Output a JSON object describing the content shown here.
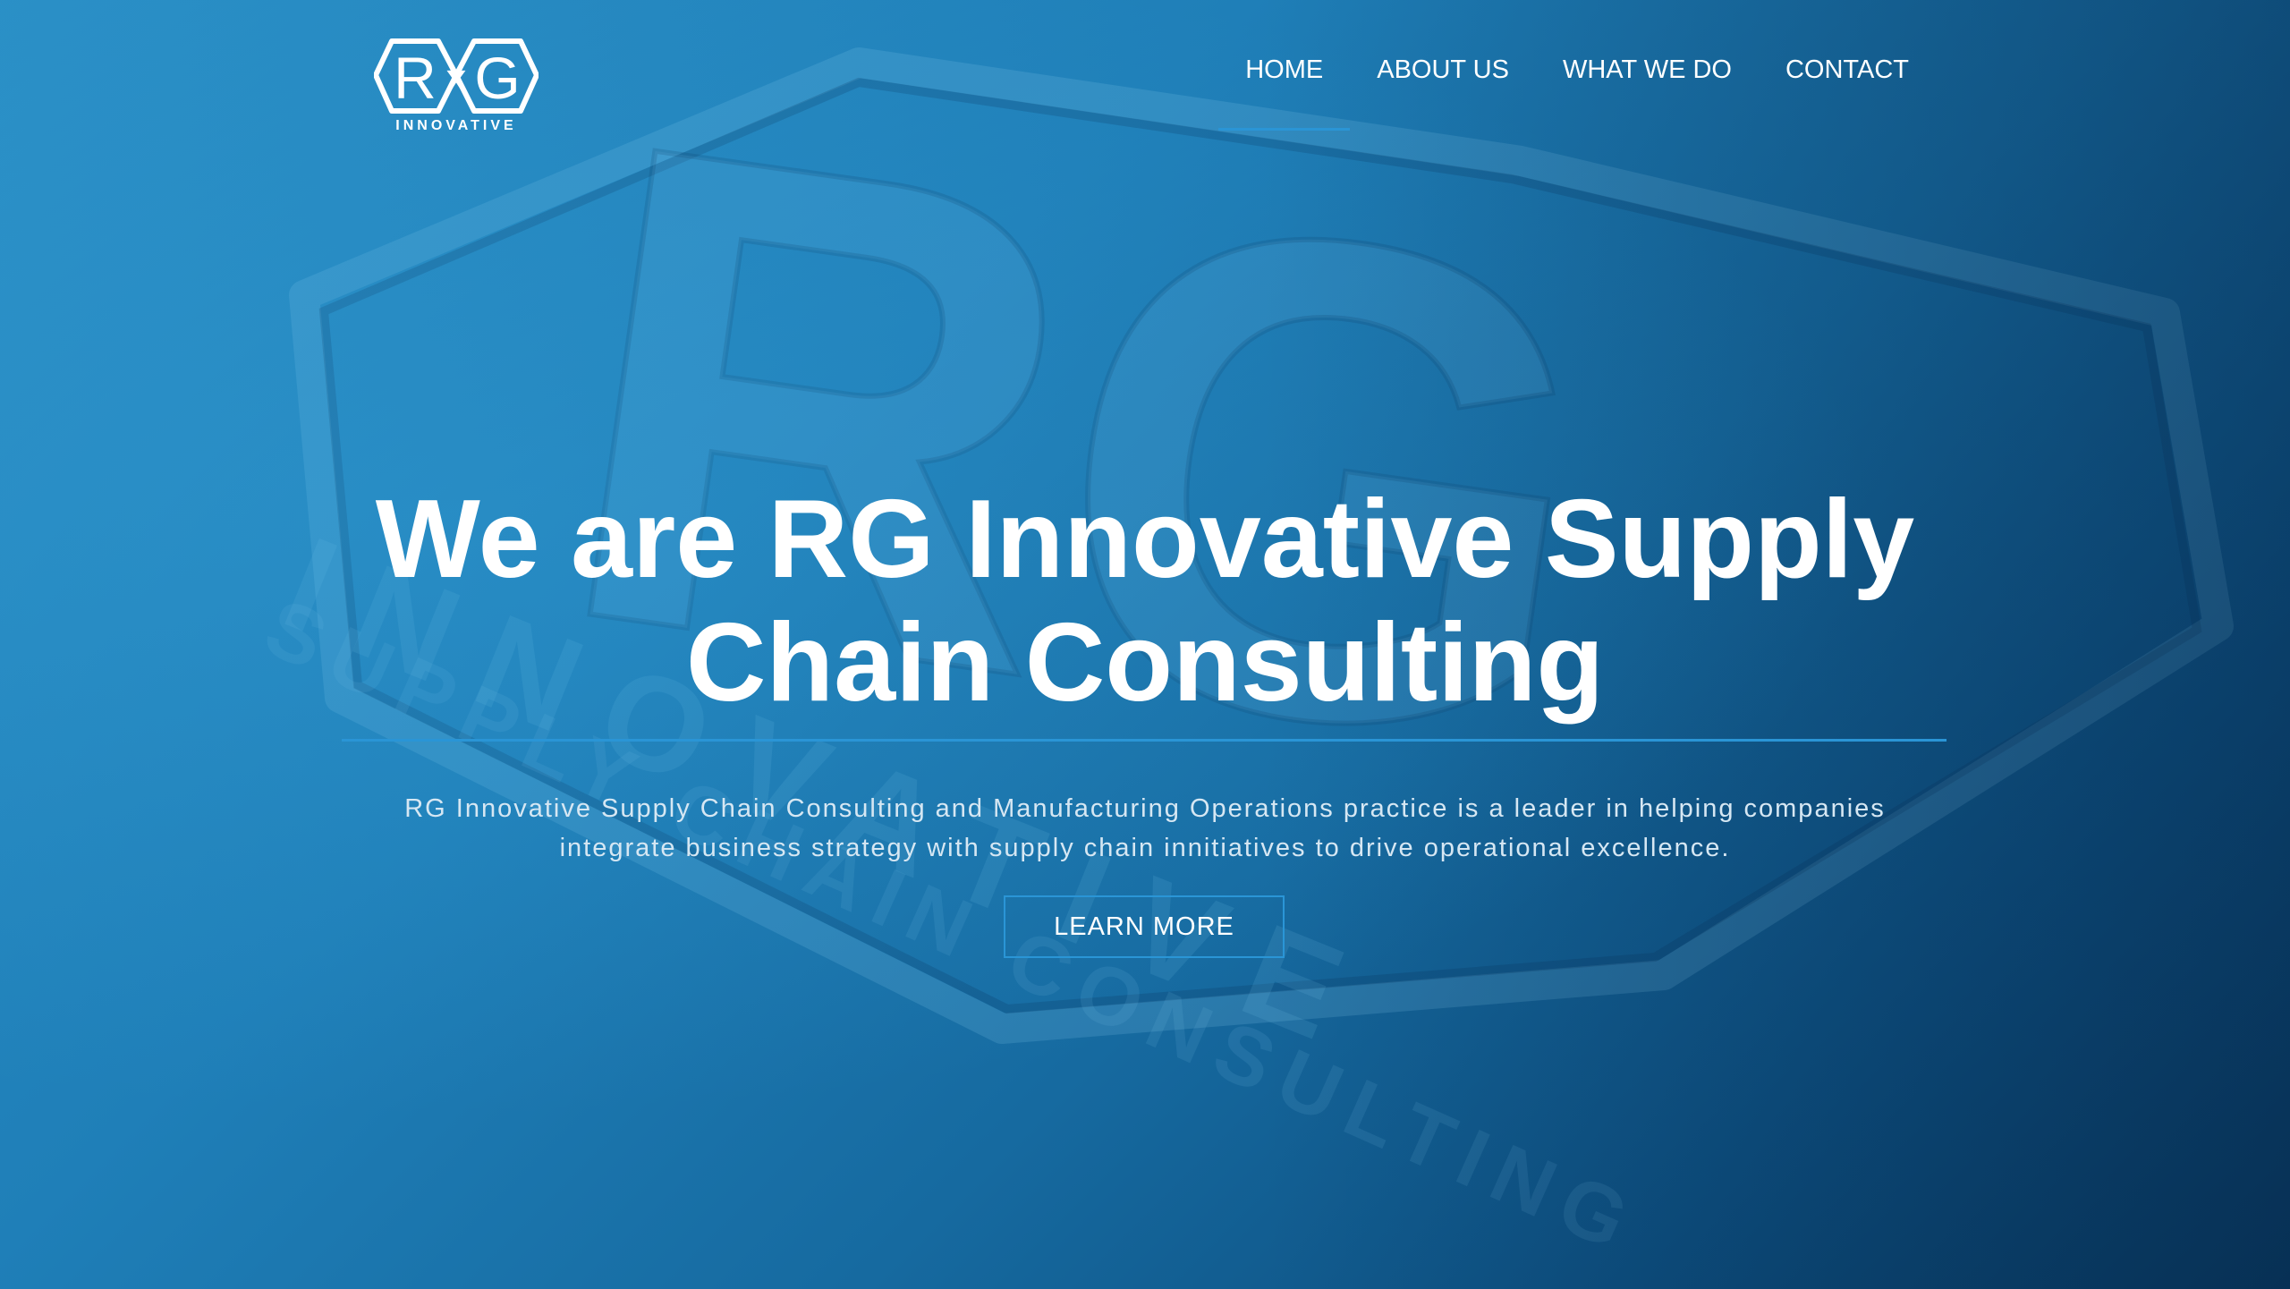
{
  "brand": {
    "logo_letters": [
      "R",
      "x",
      "G"
    ],
    "logo_subtitle": "INNOVATIVE",
    "accent_color": "#2a95d6"
  },
  "nav": {
    "items": [
      {
        "label": "HOME",
        "active": true
      },
      {
        "label": "ABOUT US",
        "active": false
      },
      {
        "label": "WHAT WE DO",
        "active": false
      },
      {
        "label": "CONTACT",
        "active": false
      }
    ]
  },
  "hero": {
    "headline_line1": "We are RG Innovative Supply",
    "headline_line2": "Chain Consulting",
    "tagline_line1": "RG Innovative Supply Chain Consulting and Manufacturing Operations practice is a leader in helping companies",
    "tagline_line2": "integrate business strategy with supply chain innitiatives to drive operational excellence.",
    "cta_label": "LEARN MORE",
    "background_art": {
      "letters": "RG",
      "word1": "INNOVATIVE",
      "word2": "SUPPLY CHAIN CONSULTING"
    }
  }
}
